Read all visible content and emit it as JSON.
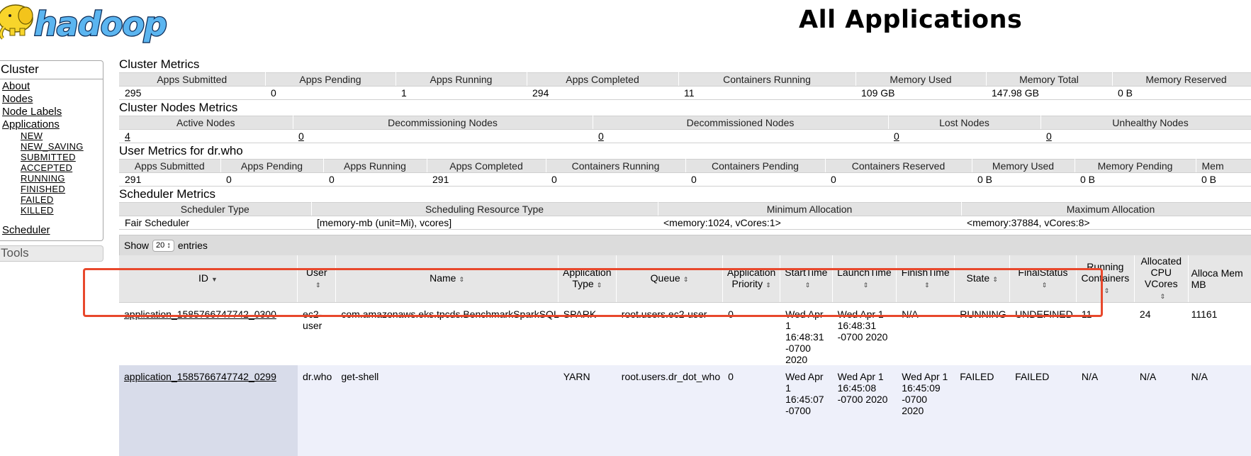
{
  "header": {
    "title": "All Applications",
    "logo_text": "hadoop"
  },
  "nav": {
    "cluster_label": "Cluster",
    "links": [
      "About",
      "Nodes",
      "Node Labels",
      "Applications"
    ],
    "app_states": [
      "NEW",
      "NEW_SAVING",
      "SUBMITTED",
      "ACCEPTED",
      "RUNNING",
      "FINISHED",
      "FAILED",
      "KILLED"
    ],
    "scheduler": "Scheduler",
    "tools_label": "Tools"
  },
  "cluster_metrics": {
    "title": "Cluster Metrics",
    "headers": [
      "Apps Submitted",
      "Apps Pending",
      "Apps Running",
      "Apps Completed",
      "Containers Running",
      "Memory Used",
      "Memory Total",
      "Memory Reserved"
    ],
    "values": [
      "295",
      "0",
      "1",
      "294",
      "11",
      "109 GB",
      "147.98 GB",
      "0 B"
    ]
  },
  "node_metrics": {
    "title": "Cluster Nodes Metrics",
    "headers": [
      "Active Nodes",
      "Decommissioning Nodes",
      "Decommissioned Nodes",
      "Lost Nodes",
      "Unhealthy Nodes"
    ],
    "values": [
      "4",
      "0",
      "0",
      "0",
      "0"
    ]
  },
  "user_metrics": {
    "title": "User Metrics for dr.who",
    "headers": [
      "Apps Submitted",
      "Apps Pending",
      "Apps Running",
      "Apps Completed",
      "Containers Running",
      "Containers Pending",
      "Containers Reserved",
      "Memory Used",
      "Memory Pending",
      "Mem"
    ],
    "values": [
      "291",
      "0",
      "0",
      "291",
      "0",
      "0",
      "0",
      "0 B",
      "0 B",
      "0 B"
    ]
  },
  "scheduler_metrics": {
    "title": "Scheduler Metrics",
    "headers": [
      "Scheduler Type",
      "Scheduling Resource Type",
      "Minimum Allocation",
      "Maximum Allocation"
    ],
    "values": [
      "Fair Scheduler",
      "[memory-mb (unit=Mi), vcores]",
      "<memory:1024, vCores:1>",
      "<memory:37884, vCores:8>"
    ]
  },
  "apps_table": {
    "show_label": "Show",
    "entries_value": "20",
    "entries_label": "entries",
    "headers": [
      "ID",
      "User",
      "Name",
      "Application Type",
      "Queue",
      "Application Priority",
      "StartTime",
      "LaunchTime",
      "FinishTime",
      "State",
      "FinalStatus",
      "Running Containers",
      "Allocated CPU VCores",
      "Alloca Mem MB"
    ],
    "rows": [
      [
        "application_1585766747742_0300",
        "ec2-user",
        "com.amazonaws.eks.tpcds.BenchmarkSparkSQL",
        "SPARK",
        "root.users.ec2-user",
        "0",
        "Wed Apr 1 16:48:31 -0700 2020",
        "Wed Apr 1 16:48:31 -0700 2020",
        "N/A",
        "RUNNING",
        "UNDEFINED",
        "11",
        "24",
        "11161"
      ],
      [
        "application_1585766747742_0299",
        "dr.who",
        "get-shell",
        "YARN",
        "root.users.dr_dot_who",
        "0",
        "Wed Apr 1 16:45:07 -0700",
        "Wed Apr 1 16:45:08 -0700 2020",
        "Wed Apr 1 16:45:09 -0700 2020",
        "FAILED",
        "FAILED",
        "N/A",
        "N/A",
        "N/A"
      ]
    ]
  },
  "colors": {
    "highlight": "#e8482c",
    "logo_blue": "#5bb5f0",
    "logo_yellow": "#f8d52b"
  }
}
